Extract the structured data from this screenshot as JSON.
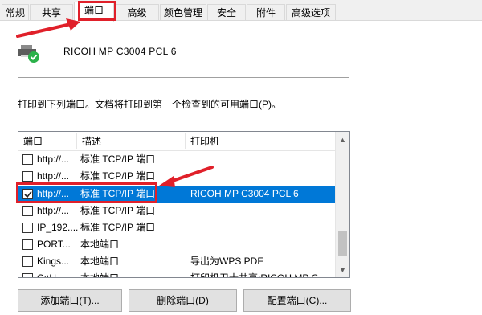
{
  "tabs": [
    {
      "label": "常规",
      "active": false
    },
    {
      "label": "共享",
      "active": false
    },
    {
      "label": "端口",
      "active": true
    },
    {
      "label": "高级",
      "active": false
    },
    {
      "label": "颜色管理",
      "active": false
    },
    {
      "label": "安全",
      "active": false
    },
    {
      "label": "附件",
      "active": false
    },
    {
      "label": "高级选项",
      "active": false
    }
  ],
  "printer": {
    "name": "RICOH MP C3004 PCL 6",
    "icon": "printer-ready-icon"
  },
  "description": "打印到下列端口。文档将打印到第一个检查到的可用端口(P)。",
  "port_list": {
    "columns": [
      "端口",
      "描述",
      "打印机"
    ],
    "rows": [
      {
        "port": "http://...",
        "desc": "标准 TCP/IP 端口",
        "printer": "",
        "checked": false,
        "selected": false
      },
      {
        "port": "http://...",
        "desc": "标准 TCP/IP 端口",
        "printer": "",
        "checked": false,
        "selected": false
      },
      {
        "port": "http://...",
        "desc": "标准 TCP/IP 端口",
        "printer": "RICOH MP C3004 PCL 6",
        "checked": true,
        "selected": true
      },
      {
        "port": "http://...",
        "desc": "标准 TCP/IP 端口",
        "printer": "",
        "checked": false,
        "selected": false
      },
      {
        "port": "IP_192....",
        "desc": "标准 TCP/IP 端口",
        "printer": "",
        "checked": false,
        "selected": false
      },
      {
        "port": "PORT...",
        "desc": "本地端口",
        "printer": "",
        "checked": false,
        "selected": false
      },
      {
        "port": "Kings...",
        "desc": "本地端口",
        "printer": "导出为WPS PDF",
        "checked": false,
        "selected": false
      },
      {
        "port": "C:\\U...",
        "desc": "本地端口",
        "printer": "打印机卫士共享:RICOH MP C...",
        "checked": false,
        "selected": false
      }
    ]
  },
  "buttons": {
    "add": "添加端口(T)...",
    "delete": "删除端口(D)",
    "configure": "配置端口(C)..."
  },
  "colors": {
    "selection": "#0078d7",
    "annotation": "#e0202a",
    "status_ok": "#2bb14a"
  }
}
